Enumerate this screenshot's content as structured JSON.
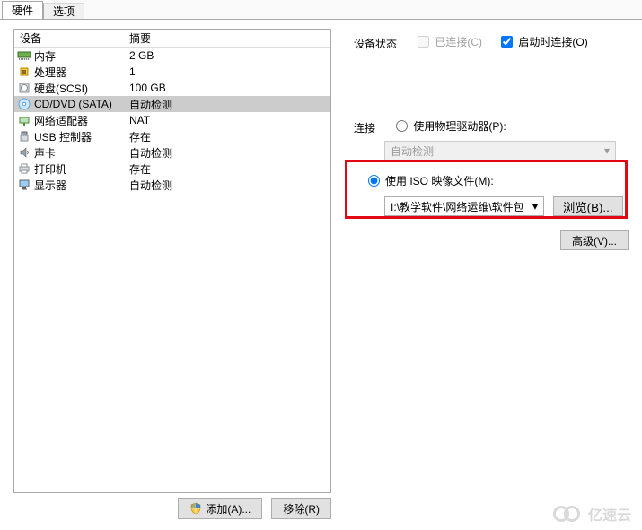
{
  "tabs": {
    "hardware": "硬件",
    "options": "选项"
  },
  "hw": {
    "col_device": "设备",
    "col_summary": "摘要",
    "rows": [
      {
        "name": "内存",
        "summary": "2 GB",
        "icon": "memory"
      },
      {
        "name": "处理器",
        "summary": "1",
        "icon": "cpu"
      },
      {
        "name": "硬盘(SCSI)",
        "summary": "100 GB",
        "icon": "hdd"
      },
      {
        "name": "CD/DVD (SATA)",
        "summary": "自动检测",
        "icon": "cd",
        "selected": true
      },
      {
        "name": "网络适配器",
        "summary": "NAT",
        "icon": "net"
      },
      {
        "name": "USB 控制器",
        "summary": "存在",
        "icon": "usb"
      },
      {
        "name": "声卡",
        "summary": "自动检测",
        "icon": "sound"
      },
      {
        "name": "打印机",
        "summary": "存在",
        "icon": "printer"
      },
      {
        "name": "显示器",
        "summary": "自动检测",
        "icon": "display"
      }
    ]
  },
  "buttons": {
    "add": "添加(A)...",
    "remove": "移除(R)",
    "browse": "浏览(B)...",
    "advanced": "高级(V)..."
  },
  "panel": {
    "device_status": "设备状态",
    "connected": "已连接(C)",
    "connect_at_poweron": "启动时连接(O)",
    "connection": "连接",
    "use_physical": "使用物理驱动器(P):",
    "physical_value": "自动检测",
    "use_iso": "使用 ISO 映像文件(M):",
    "iso_path": "I:\\教学软件\\网络运维\\软件包"
  },
  "watermark": "亿速云"
}
